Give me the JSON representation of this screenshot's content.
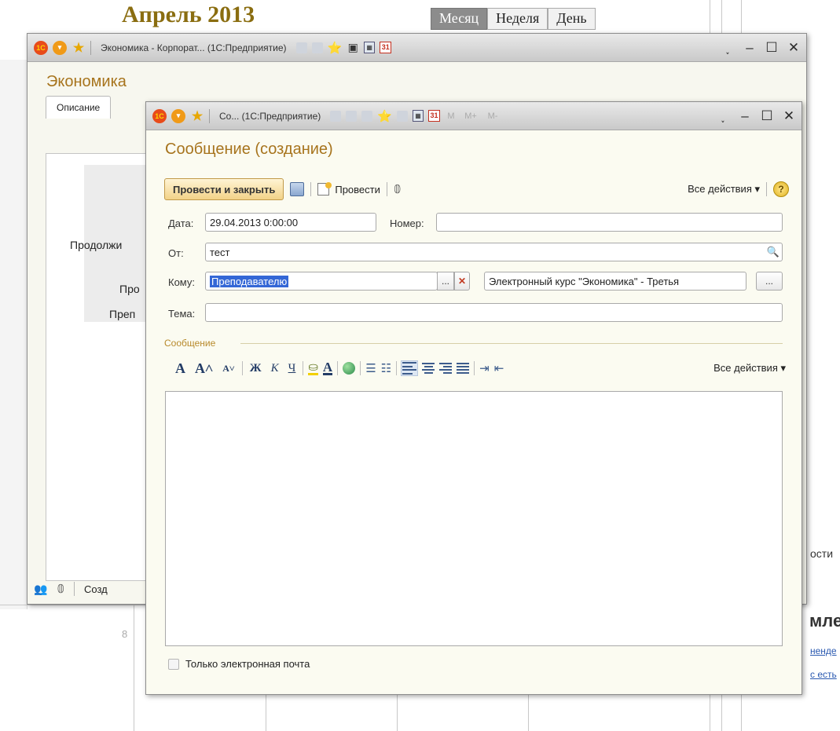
{
  "calendar": {
    "month_title": "Апрель 2013",
    "view_tabs": [
      "Месяц",
      "Неделя",
      "День"
    ],
    "active_view": "Месяц",
    "day_number": "8",
    "side_texts": [
      "ости",
      "мле",
      "ненде",
      "с есть"
    ]
  },
  "back_window": {
    "titlebar_text": "Экономика - Корпорат... (1С:Предприятие)",
    "form_title": "Экономика",
    "tab_label": "Описание",
    "labels": [
      "Продолжи",
      "Про",
      "Преп"
    ],
    "footer_create": "Созд"
  },
  "front_window": {
    "titlebar_text": "Со... (1С:Предприятие)",
    "titlebar_m_buttons": [
      "M",
      "M+",
      "M-"
    ],
    "form_title": "Сообщение (создание)",
    "toolbar": {
      "post_and_close": "Провести и закрыть",
      "post": "Провести",
      "all_actions": "Все действия ▾",
      "help": "?"
    },
    "fields": {
      "date_label": "Дата:",
      "date_value": "29.04.2013  0:00:00",
      "number_label": "Номер:",
      "number_value": "",
      "from_label": "От:",
      "from_value": "тест",
      "to_label": "Кому:",
      "to_value": "Преподавателю",
      "course_value": "Электронный курс \"Экономика\" - Третья",
      "subject_label": "Тема:",
      "subject_value": ""
    },
    "message_group_label": "Сообщение",
    "format_toolbar": {
      "bold": "Ж",
      "italic": "К",
      "underline": "Ч",
      "all_actions": "Все действия ▾"
    },
    "message_body": "",
    "email_only_label": "Только электронная почта",
    "email_only_checked": false
  }
}
